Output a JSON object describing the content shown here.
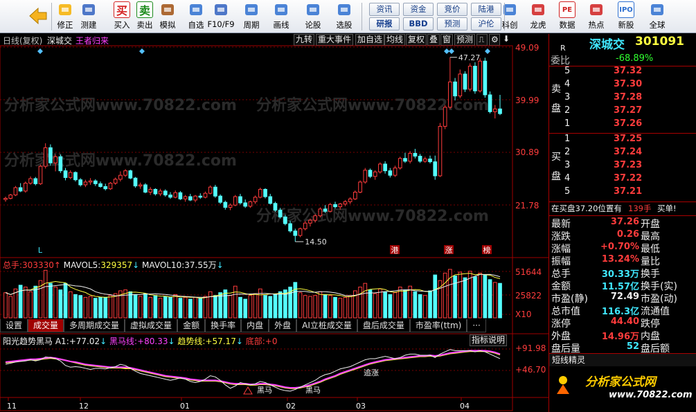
{
  "toolbar": {
    "back_label": "",
    "buttons": [
      {
        "label": "修正",
        "icon": "arrows-updown-icon"
      },
      {
        "label": "测建",
        "icon": "clock-icon"
      },
      {
        "label": "买入",
        "icon": "buy-icon",
        "glyph": "买"
      },
      {
        "label": "卖出",
        "icon": "sell-icon",
        "glyph": "卖"
      },
      {
        "label": "模拟",
        "icon": "gavel-icon"
      },
      {
        "label": "自选",
        "icon": "star-icon"
      },
      {
        "label": "F10/F9",
        "icon": "report-icon"
      },
      {
        "label": "周期",
        "icon": "clock-icon"
      },
      {
        "label": "画线",
        "icon": "pencil-icon"
      },
      {
        "label": "论股",
        "icon": "forum-icon"
      },
      {
        "label": "选股",
        "icon": "magnify-icon"
      },
      {
        "label": "科创",
        "icon": "chart-line-icon"
      },
      {
        "label": "龙虎",
        "icon": "dragon-icon"
      },
      {
        "label": "数据",
        "icon": "pe-icon",
        "glyph": "PE"
      },
      {
        "label": "热点",
        "icon": "fire-icon"
      },
      {
        "label": "新股",
        "icon": "ipo-icon",
        "glyph": "IPO"
      },
      {
        "label": "全球",
        "icon": "globe-icon"
      }
    ],
    "small": [
      "资讯",
      "资金",
      "竞价",
      "陆港",
      "研报",
      "BBD",
      "预测",
      "沪伦"
    ]
  },
  "chart_header": {
    "mode": "日线(复权)",
    "stock_name": "深城交",
    "indicator_name": "王者归来",
    "buttons": [
      "九转",
      "重大事件",
      "加自选",
      "均线",
      "复权",
      "叠",
      "窗",
      "预测"
    ]
  },
  "price_axis": [
    "49.09",
    "39.99",
    "30.89",
    "21.78"
  ],
  "annotations": {
    "high": "47.27",
    "low": "14.50",
    "markers": [
      "L",
      "港",
      "涨",
      "榜"
    ]
  },
  "volume": {
    "label_total": "总手:",
    "total": "303330",
    "label_ma5": "MAVOL5:",
    "ma5": "329357",
    "label_ma10": "MAVOL10:",
    "ma10": "37.55万",
    "axis": [
      "51644",
      "25822",
      "X10"
    ]
  },
  "tabs": [
    "设置",
    "成交量",
    "多周期成交量",
    "虚拟成交量",
    "金额",
    "换手率",
    "内盘",
    "外盘",
    "AI立桩成交量",
    "盘后成交量",
    "市盈率(ttm)",
    "···"
  ],
  "indicator": {
    "name": "阳光趋势黑马",
    "a1_label": "A1:",
    "a1": "+77.02",
    "hm_label": "黑马线:",
    "hm": "+80.33",
    "trend_label": "趋势线:",
    "trend": "+57.17",
    "bottom_label": "底部:",
    "bottom": "+0",
    "help": "指标说明",
    "axis": [
      "+91.98",
      "+46.70"
    ],
    "labels": [
      "黑马",
      "黑马",
      "追涨"
    ]
  },
  "date_axis": [
    "11",
    "12",
    "01",
    "02",
    "03",
    "04"
  ],
  "right_panel": {
    "title": "深城交",
    "code": "301091",
    "r": "R",
    "weibi_label": "委比",
    "weibi": "-68.89%",
    "sell_label": "卖盘",
    "sells": [
      {
        "n": "5",
        "p": "37.32"
      },
      {
        "n": "4",
        "p": "37.30"
      },
      {
        "n": "3",
        "p": "37.28"
      },
      {
        "n": "2",
        "p": "37.27"
      },
      {
        "n": "1",
        "p": "37.26"
      }
    ],
    "buy_label": "买盘",
    "buys": [
      {
        "n": "1",
        "p": "37.25"
      },
      {
        "n": "2",
        "p": "37.24"
      },
      {
        "n": "3",
        "p": "37.23"
      },
      {
        "n": "4",
        "p": "37.22"
      },
      {
        "n": "5",
        "p": "37.21"
      }
    ],
    "notice": "在买盘37.20位置有",
    "notice_qty": "139手",
    "notice_act": "买单!",
    "stats": [
      {
        "l1": "最新",
        "v1": "37.26",
        "l2": "开盘",
        "v2": ""
      },
      {
        "l1": "涨跌",
        "v1": "0.26",
        "l2": "最高",
        "v2": ""
      },
      {
        "l1": "涨幅",
        "v1": "+0.70%",
        "l2": "最低",
        "v2": ""
      },
      {
        "l1": "振幅",
        "v1": "13.24%",
        "l2": "量比",
        "v2": ""
      },
      {
        "l1": "总手",
        "v1": "30.33万",
        "l2": "换手",
        "v2": ""
      },
      {
        "l1": "金额",
        "v1": "11.57亿",
        "l2": "换手(实)",
        "v2": ""
      },
      {
        "l1": "市盈(静)",
        "v1": "72.49",
        "l2": "市盈(动)",
        "v2": ""
      },
      {
        "l1": "总市值",
        "v1": "116.3亿",
        "l2": "流通值",
        "v2": ""
      },
      {
        "l1": "涨停",
        "v1": "44.40",
        "l2": "跌停",
        "v2": ""
      },
      {
        "l1": "外盘",
        "v1": "14.96万",
        "l2": "内盘",
        "v2": ""
      },
      {
        "l1": "盘后量",
        "v1": "52",
        "l2": "盘后额",
        "v2": ""
      }
    ],
    "short_title": "短线精灵",
    "logo_text": "分析家公式网",
    "logo_url": "www.70822.com"
  },
  "watermark": "分析家公式网www.70822.com",
  "chart_data": {
    "type": "candlestick",
    "title": "",
    "ylim": [
      14.5,
      49.09
    ],
    "candles": [
      [
        22,
        22.5,
        21.6,
        22.2
      ],
      [
        22.2,
        23,
        22,
        22.8
      ],
      [
        22.8,
        24.4,
        22.6,
        24.1
      ],
      [
        24.1,
        24.9,
        23.3,
        23.5
      ],
      [
        23.5,
        25.2,
        23.2,
        24.9
      ],
      [
        24.9,
        26.1,
        24.6,
        25.7
      ],
      [
        25.7,
        26,
        24.5,
        24.8
      ],
      [
        24.8,
        28.2,
        24.6,
        27.9
      ],
      [
        27.9,
        32,
        27.5,
        31.2
      ],
      [
        31.2,
        31.8,
        28,
        28.5
      ],
      [
        28.5,
        30,
        27,
        29.6
      ],
      [
        29.6,
        30,
        26.7,
        27.1
      ],
      [
        27.1,
        27.6,
        25.4,
        25.9
      ],
      [
        25.9,
        27.2,
        25.6,
        26.8
      ],
      [
        26.8,
        27,
        25.2,
        25.5
      ],
      [
        25.5,
        25.8,
        24.3,
        24.6
      ],
      [
        24.6,
        25.5,
        24.2,
        25.1
      ],
      [
        25.1,
        25.8,
        24.6,
        25.3
      ],
      [
        25.3,
        25.6,
        24.4,
        24.8
      ],
      [
        24.8,
        25.2,
        24.1,
        24.3
      ],
      [
        24.3,
        24.8,
        23.6,
        23.9
      ],
      [
        23.9,
        25.1,
        23.7,
        24.9
      ],
      [
        24.9,
        25.9,
        24.6,
        25.6
      ],
      [
        25.6,
        27,
        25.2,
        26.3
      ],
      [
        26.3,
        27.4,
        26,
        27.1
      ],
      [
        27.1,
        27.3,
        25.6,
        25.8
      ],
      [
        25.8,
        26,
        24.1,
        24.4
      ],
      [
        24.4,
        25,
        23.9,
        24.6
      ],
      [
        24.6,
        24.9,
        23.1,
        23.3
      ],
      [
        23.3,
        24.2,
        22.8,
        23.8
      ],
      [
        23.8,
        24,
        22.7,
        23
      ],
      [
        23,
        23.9,
        22.6,
        23.5
      ],
      [
        23.5,
        23.8,
        22.5,
        22.8
      ],
      [
        22.8,
        23.3,
        22.1,
        22.4
      ],
      [
        22.4,
        23.6,
        22.2,
        23.2
      ],
      [
        23.2,
        23.5,
        21.9,
        22.1
      ],
      [
        22.1,
        22.8,
        21.6,
        22.5
      ],
      [
        22.5,
        23,
        21.7,
        21.9
      ],
      [
        21.9,
        22.8,
        21.5,
        22.6
      ],
      [
        22.6,
        23.1,
        22.1,
        22.4
      ],
      [
        22.4,
        23.4,
        22.2,
        23.1
      ],
      [
        23.1,
        24.5,
        22.9,
        24.2
      ],
      [
        24.2,
        24.6,
        22.3,
        22.6
      ],
      [
        22.6,
        22.9,
        21.2,
        21.5
      ],
      [
        21.5,
        21.8,
        20.2,
        20.6
      ],
      [
        20.6,
        21.3,
        20.1,
        21
      ],
      [
        21,
        22.8,
        20.8,
        22.5
      ],
      [
        22.5,
        23,
        21.1,
        21.4
      ],
      [
        21.4,
        22,
        20.5,
        20.8
      ],
      [
        20.8,
        21.8,
        20.5,
        21.6
      ],
      [
        21.6,
        22.7,
        21.2,
        22.4
      ],
      [
        22.4,
        24.1,
        22.2,
        23.8
      ],
      [
        23.8,
        24,
        22.2,
        22.5
      ],
      [
        22.5,
        23,
        21.1,
        21.3
      ],
      [
        21.3,
        21.6,
        19.8,
        20.1
      ],
      [
        20.1,
        20.5,
        18.6,
        18.9
      ],
      [
        18.9,
        19.3,
        17.4,
        17.7
      ],
      [
        17.7,
        18.2,
        16.1,
        16.4
      ],
      [
        16.4,
        16.8,
        14.5,
        15.6
      ],
      [
        15.6,
        17,
        15.3,
        16.8
      ],
      [
        16.8,
        18.2,
        16.5,
        17.8
      ],
      [
        17.8,
        18.6,
        17.2,
        18.3
      ],
      [
        18.3,
        19.4,
        17.9,
        19.1
      ],
      [
        19.1,
        20.6,
        18.8,
        20.3
      ],
      [
        20.3,
        21,
        19.6,
        19.9
      ],
      [
        19.9,
        21.4,
        19.7,
        21.1
      ],
      [
        21.1,
        21.6,
        20.4,
        20.7
      ],
      [
        20.7,
        21.4,
        20.2,
        21.2
      ],
      [
        21.2,
        21.9,
        20.8,
        21.6
      ],
      [
        21.6,
        22.4,
        21.2,
        22.1
      ],
      [
        22.1,
        23.6,
        21.9,
        23.3
      ],
      [
        23.3,
        25.4,
        23.1,
        25.1
      ],
      [
        25.1,
        27.6,
        24.8,
        27.2
      ],
      [
        27.2,
        27.5,
        25.8,
        26.1
      ],
      [
        26.1,
        27.2,
        25.5,
        26.9
      ],
      [
        26.9,
        28.6,
        26.6,
        28.3
      ],
      [
        28.3,
        28.8,
        26.6,
        27.1
      ],
      [
        27.1,
        27.6,
        25.9,
        26.3
      ],
      [
        26.3,
        28,
        26,
        27.6
      ],
      [
        27.6,
        29.6,
        27.3,
        29.3
      ],
      [
        29.3,
        30.3,
        28.5,
        28.8
      ],
      [
        28.8,
        30.6,
        28.4,
        30.2
      ],
      [
        30.2,
        31,
        29.3,
        29.7
      ],
      [
        29.7,
        30.1,
        28.5,
        28.8
      ],
      [
        28.8,
        29.6,
        28.5,
        29.2
      ],
      [
        29.2,
        29.8,
        28.4,
        28.7
      ],
      [
        28.7,
        29.8,
        25.5,
        26.2
      ],
      [
        26.2,
        35.6,
        26,
        35
      ],
      [
        35,
        38.8,
        34.5,
        38.4
      ],
      [
        38.4,
        47.27,
        38.1,
        42.9
      ],
      [
        42.9,
        43.6,
        39.6,
        40.4
      ],
      [
        40.4,
        45.1,
        40,
        44.3
      ],
      [
        44.3,
        44.8,
        41.1,
        41.6
      ],
      [
        41.6,
        46.2,
        41.2,
        45.7
      ],
      [
        45.7,
        46.4,
        40.8,
        41.3
      ],
      [
        41.3,
        47.1,
        41,
        46.6
      ],
      [
        46.6,
        47.2,
        40.1,
        40.6
      ],
      [
        40.6,
        41.2,
        37.3,
        37.6
      ],
      [
        37.6,
        38.8,
        36.4,
        38.1
      ],
      [
        38.1,
        40.6,
        37,
        37.26
      ]
    ],
    "volume": [
      27,
      23,
      31,
      35,
      33,
      28,
      34,
      40,
      51,
      37,
      33,
      30,
      37,
      28,
      25,
      24,
      22,
      23,
      21,
      22,
      22,
      24,
      26,
      29,
      30,
      28,
      25,
      23,
      26,
      22,
      24,
      21,
      23,
      22,
      25,
      21,
      22,
      20,
      22,
      21,
      23,
      28,
      24,
      27,
      30,
      24,
      34,
      22,
      20,
      24,
      26,
      31,
      24,
      23,
      25,
      28,
      30,
      33,
      38,
      27,
      24,
      23,
      24,
      28,
      25,
      24,
      22,
      21,
      22,
      24,
      29,
      33,
      37,
      30,
      26,
      31,
      28,
      25,
      27,
      33,
      30,
      34,
      28,
      25,
      24,
      29,
      46,
      40,
      48,
      52,
      45,
      49,
      43,
      50,
      44,
      48,
      46,
      41,
      38,
      37
    ],
    "indicator_lines": {
      "a1": [
        62,
        64,
        66,
        67,
        68,
        70,
        68,
        70,
        75,
        74,
        72,
        68,
        60,
        57,
        58,
        57,
        55,
        53,
        55,
        55,
        54,
        56,
        58,
        62,
        60,
        55,
        50,
        46,
        44,
        42,
        40,
        38,
        36,
        34,
        36,
        38,
        36,
        32,
        30,
        32,
        36,
        42,
        40,
        34,
        26,
        20,
        24,
        30,
        28,
        26,
        28,
        32,
        30,
        26,
        22,
        18,
        16,
        15,
        18,
        22,
        26,
        30,
        34,
        40,
        44,
        46,
        50,
        54,
        56,
        58,
        62,
        66,
        70,
        72,
        72,
        74,
        76,
        74,
        72,
        74,
        78,
        80,
        80,
        78,
        78,
        78,
        74,
        80,
        84,
        88,
        86,
        86,
        86,
        86,
        84,
        86,
        84,
        80,
        76,
        72
      ],
      "hm": [
        66,
        67,
        68,
        69,
        70,
        71,
        71,
        72,
        73,
        74,
        73,
        71,
        69,
        67,
        66,
        64,
        62,
        61,
        60,
        59,
        58,
        57,
        57,
        57,
        57,
        56,
        54,
        52,
        50,
        48,
        46,
        44,
        42,
        41,
        40,
        39,
        38,
        36,
        35,
        34,
        34,
        34,
        34,
        33,
        31,
        29,
        28,
        28,
        28,
        27,
        27,
        28,
        28,
        27,
        26,
        24,
        22,
        21,
        21,
        22,
        24,
        26,
        29,
        32,
        36,
        39,
        42,
        46,
        49,
        52,
        55,
        58,
        61,
        64,
        66,
        68,
        70,
        71,
        72,
        73,
        74,
        75,
        76,
        77,
        77,
        78,
        77,
        78,
        80,
        82,
        83,
        84,
        85,
        86,
        86,
        86,
        86,
        85,
        83,
        80
      ],
      "trend": [
        65,
        66,
        67,
        68,
        69,
        70,
        70,
        71,
        72,
        73,
        72,
        71,
        69,
        67,
        65,
        63,
        61,
        60,
        59,
        58,
        57,
        56,
        56,
        56,
        55,
        55,
        53,
        51,
        49,
        47,
        45,
        43,
        41,
        40,
        39,
        38,
        37,
        35,
        34,
        33,
        33,
        33,
        33,
        32,
        30,
        28,
        27,
        27,
        27,
        26,
        26,
        27,
        27,
        26,
        25,
        23,
        21,
        20,
        20,
        21,
        23,
        25,
        28,
        31,
        35,
        38,
        41,
        45,
        48,
        51,
        54,
        57,
        60,
        63,
        65,
        67,
        69,
        70,
        71,
        72,
        73,
        74,
        75,
        76,
        76,
        77,
        76,
        77,
        79,
        81,
        82,
        83,
        84,
        85,
        85,
        85,
        85,
        84,
        82,
        79
      ]
    }
  }
}
